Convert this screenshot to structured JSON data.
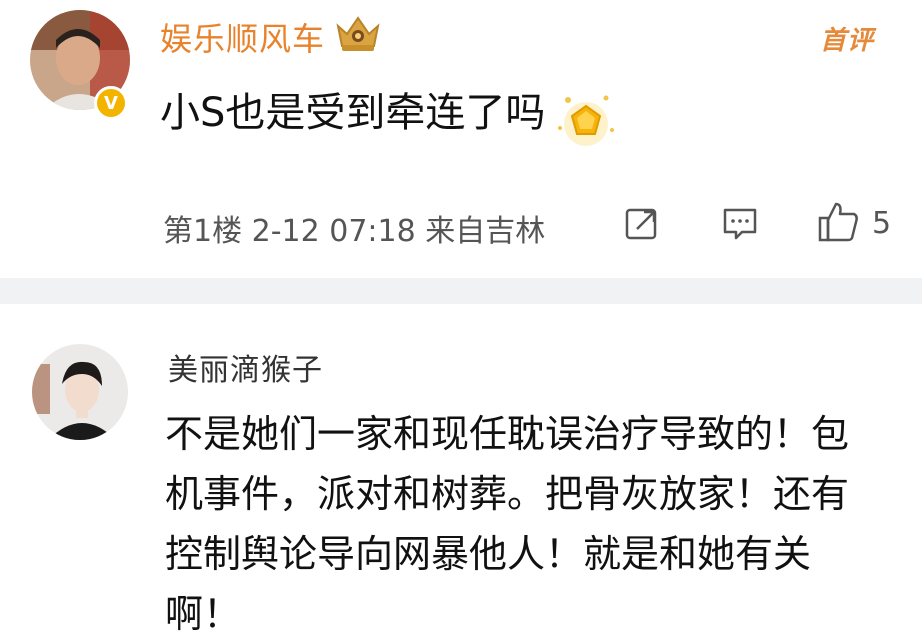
{
  "comments": [
    {
      "username": "娱乐顺风车",
      "verified_badge": "V",
      "badge_color": "#f3b400",
      "username_color": "#e8822b",
      "first_rating": "首评",
      "text": "小S也是受到牵连了吗",
      "meta": "第1楼 2-12 07:18 来自吉林",
      "like_count": "5",
      "icons": [
        "crown-badge-icon",
        "sparkle-reward-icon",
        "repost-icon",
        "comment-icon",
        "thumbs-up-icon"
      ]
    },
    {
      "username": "美丽滴猴子",
      "text": "不是她们一家和现任耽误治疗导致的！包机事件，派对和树葬。把骨灰放家！还有控制舆论导向网暴他人！就是和她有关啊！"
    }
  ]
}
